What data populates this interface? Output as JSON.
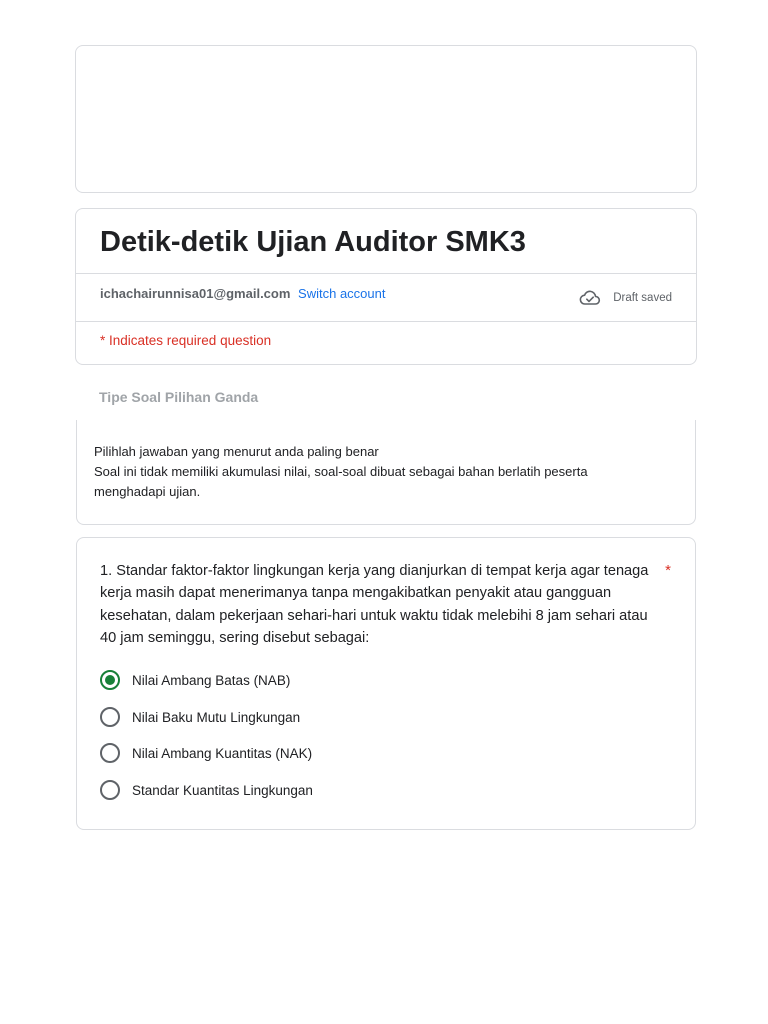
{
  "header": {
    "title": "Detik-detik Ujian Auditor SMK3",
    "account_email": "ichachairunnisa01@gmail.com",
    "switch_account": "Switch account",
    "draft_status": "Draft saved",
    "required_note": "* Indicates required question"
  },
  "section": {
    "title": "Tipe Soal Pilihan Ganda",
    "description_lines": [
      "Pilihlah jawaban yang menurut anda paling benar",
      "Soal ini tidak memiliki akumulasi nilai, soal-soal dibuat sebagai bahan berlatih peserta",
      "menghadapi ujian."
    ]
  },
  "question": {
    "text": "1. Standar faktor-faktor lingkungan kerja yang dianjurkan di tempat kerja agar tenaga kerja masih dapat menerimanya tanpa mengakibatkan penyakit atau gangguan kesehatan, dalam pekerjaan sehari-hari untuk waktu tidak melebihi 8 jam sehari atau 40 jam seminggu, sering disebut sebagai:",
    "required_mark": "*",
    "options": [
      {
        "label": "Nilai Ambang Batas (NAB)",
        "selected": true
      },
      {
        "label": "Nilai Baku Mutu Lingkungan",
        "selected": false
      },
      {
        "label": "Nilai Ambang Kuantitas (NAK)",
        "selected": false
      },
      {
        "label": "Standar Kuantitas Lingkungan",
        "selected": false
      }
    ]
  },
  "colors": {
    "accent": "#1a73e8",
    "required": "#d93025",
    "selected_radio": "#188038",
    "border": "#dadce0"
  },
  "icons": {
    "draft": "cloud-check-icon",
    "radio_selected": "radio-checked-icon",
    "radio_empty": "radio-unchecked-icon"
  }
}
